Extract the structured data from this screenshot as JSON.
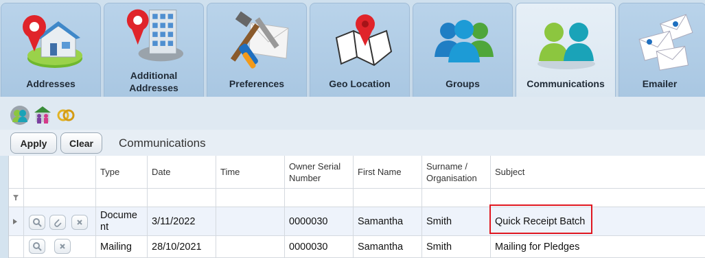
{
  "tabs": [
    {
      "label": "Addresses",
      "icon": "house-pin-icon"
    },
    {
      "label": "Additional\nAddresses",
      "icon": "building-pin-icon"
    },
    {
      "label": "Preferences",
      "icon": "tools-icon"
    },
    {
      "label": "Geo Location",
      "icon": "map-pin-icon"
    },
    {
      "label": "Groups",
      "icon": "people-group-icon"
    },
    {
      "label": "Communications",
      "icon": "communication-people-icon",
      "active": true
    },
    {
      "label": "Emailer",
      "icon": "envelopes-icon"
    }
  ],
  "toolbar": {
    "apply_label": "Apply",
    "clear_label": "Clear",
    "section_title": "Communications"
  },
  "grid": {
    "columns": [
      "Type",
      "Date",
      "Time",
      "Owner Serial\nNumber",
      "First Name",
      "Surname /\nOrganisation",
      "Subject"
    ],
    "rows": [
      {
        "type": "Docume\nnt",
        "date": "3/11/2022",
        "time": "",
        "owner_serial": "0000030",
        "first_name": "Samantha",
        "surname": "Smith",
        "subject": "Quick Receipt Batch"
      },
      {
        "type": "Mailing",
        "date": "28/10/2021",
        "time": "",
        "owner_serial": "0000030",
        "first_name": "Samantha",
        "surname": "Smith",
        "subject": "Mailing for Pledges"
      }
    ]
  },
  "colors": {
    "tab_bg": "#b9d3ea",
    "tab_active_bg": "#e6eff7",
    "highlight": "#e0161f",
    "row_selected": "#eef3fb"
  }
}
